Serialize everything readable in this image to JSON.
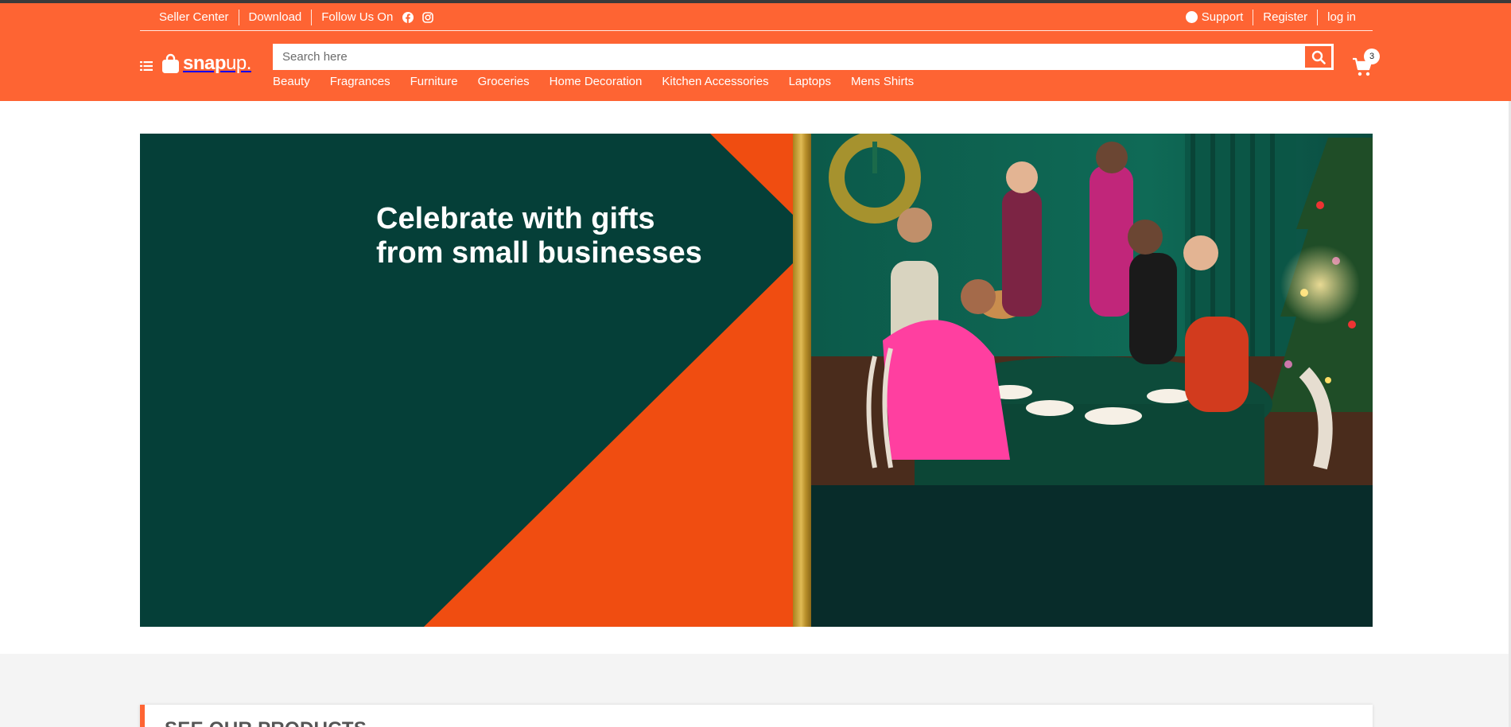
{
  "topbar": {
    "seller_center": "Seller Center",
    "download": "Download",
    "follow_us": "Follow Us On",
    "support": "Support",
    "register": "Register",
    "login": "log in"
  },
  "logo": {
    "brand_bold": "snap",
    "brand_thin": "up."
  },
  "search": {
    "placeholder": "Search here",
    "value": ""
  },
  "cart": {
    "count": "3"
  },
  "categories": [
    "Beauty",
    "Fragrances",
    "Furniture",
    "Groceries",
    "Home Decoration",
    "Kitchen Accessories",
    "Laptops",
    "Mens Shirts"
  ],
  "banner": {
    "title_line1": "Celebrate with gifts",
    "title_line2": "from small businesses"
  },
  "products": {
    "title": "SEE OUR PRODUCTS"
  },
  "colors": {
    "brand": "#fe6433",
    "banner_dark": "#053f38",
    "banner_orange": "#f04d11"
  },
  "icons": [
    "menu-list-icon",
    "shopping-bag-icon",
    "facebook-icon",
    "instagram-icon",
    "question-circle-icon",
    "search-icon",
    "cart-icon"
  ]
}
